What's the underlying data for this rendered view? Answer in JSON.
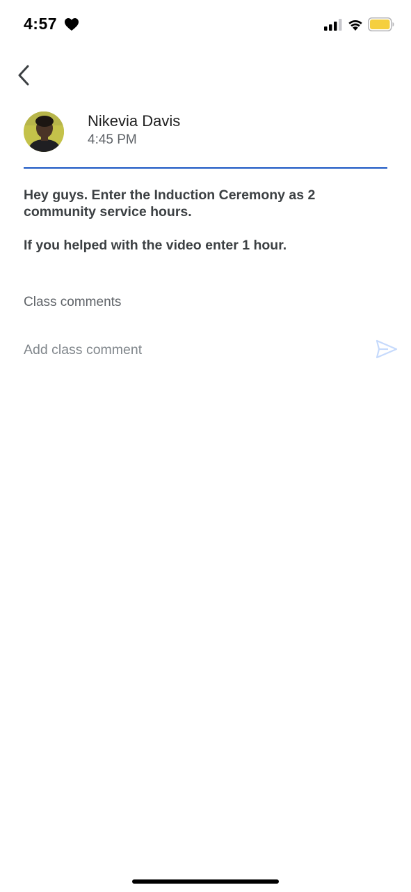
{
  "status_bar": {
    "time": "4:57",
    "icons": [
      "heart-icon",
      "signal-icon",
      "wifi-icon",
      "battery-icon"
    ],
    "battery_color": "#f5cf3e"
  },
  "header": {
    "back_icon": "chevron-left-icon",
    "author_name": "Nikevia Davis",
    "post_time": "4:45 PM",
    "divider_color": "#1a56c4"
  },
  "post": {
    "paragraphs": [
      "Hey guys. Enter the Induction Ceremony as 2 community service hours.",
      "If you helped with the video enter 1 hour."
    ]
  },
  "comments": {
    "heading": "Class comments",
    "input_placeholder": "Add class comment",
    "send_icon": "send-icon"
  }
}
